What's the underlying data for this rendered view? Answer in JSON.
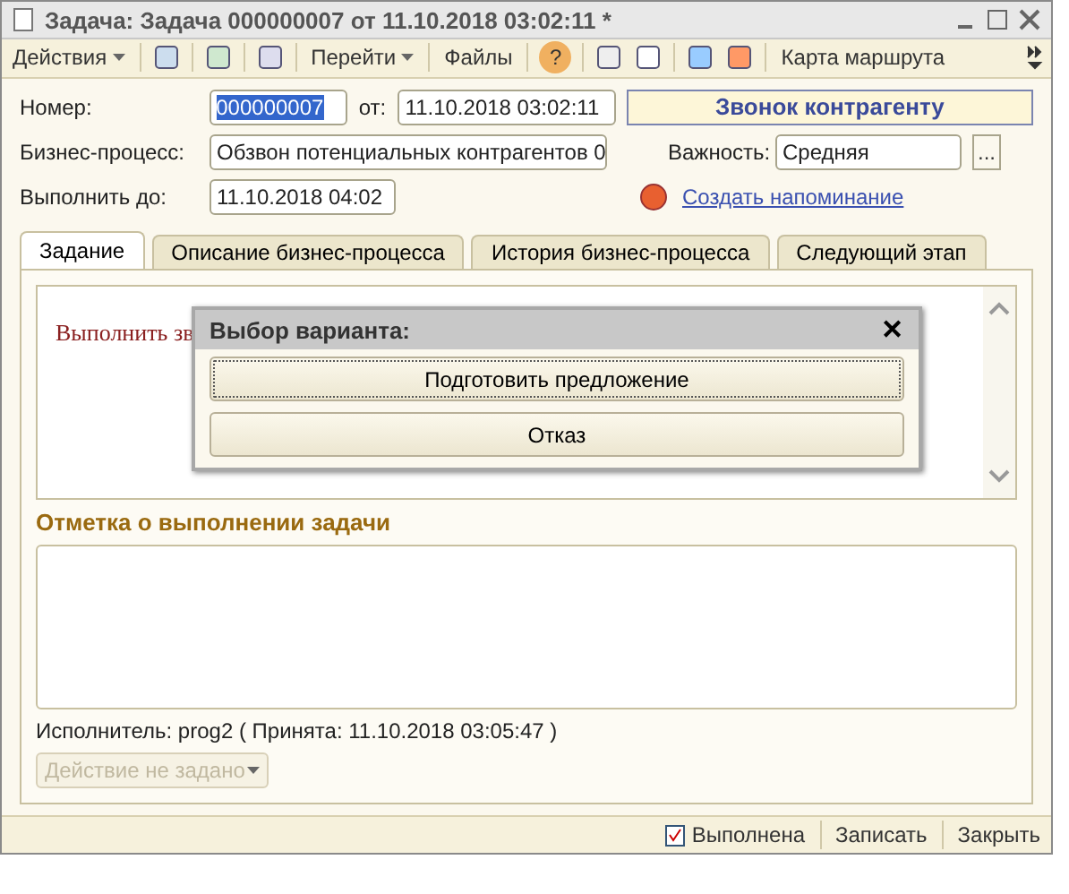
{
  "window": {
    "title": "Задача: Задача 000000007 от 11.10.2018 03:02:11 *"
  },
  "toolbar": {
    "actions": "Действия",
    "goto": "Перейти",
    "files": "Файлы",
    "help": "?",
    "route_map": "Карта маршрута"
  },
  "form": {
    "number_label": "Номер:",
    "number": "000000007",
    "date_label": "от:",
    "date": "11.10.2018 03:02:11",
    "task_name": "Звонок контрагенту",
    "process_label": "Бизнес-процесс:",
    "process": "Обзвон потенциальных контрагентов 0",
    "importance_label": "Важность:",
    "importance": "Средняя",
    "importance_button": "...",
    "due_label": "Выполнить до:",
    "due": "11.10.2018  04:02",
    "reminder_link": "Создать напоминание"
  },
  "tabs": [
    {
      "label": "Задание",
      "selected": true
    },
    {
      "label": "Описание бизнес-процесса",
      "selected": false
    },
    {
      "label": "История бизнес-процесса",
      "selected": false
    },
    {
      "label": "Следующий этап",
      "selected": false
    }
  ],
  "task_text": "Выполнить зв",
  "dialog": {
    "title": "Выбор варианта:",
    "close": "✕",
    "options": [
      {
        "label": "Подготовить предложение",
        "selected": true
      },
      {
        "label": "Отказ",
        "selected": false
      }
    ]
  },
  "completion": {
    "label": "Отметка о выполнении задачи"
  },
  "executor": "Исполнитель:  prog2  ( Принята: 11.10.2018 03:05:47 )",
  "action_select": {
    "value": "Действие не задано",
    "disabled": true
  },
  "footer": {
    "done": "Выполнена",
    "save": "Записать",
    "close": "Закрыть"
  }
}
